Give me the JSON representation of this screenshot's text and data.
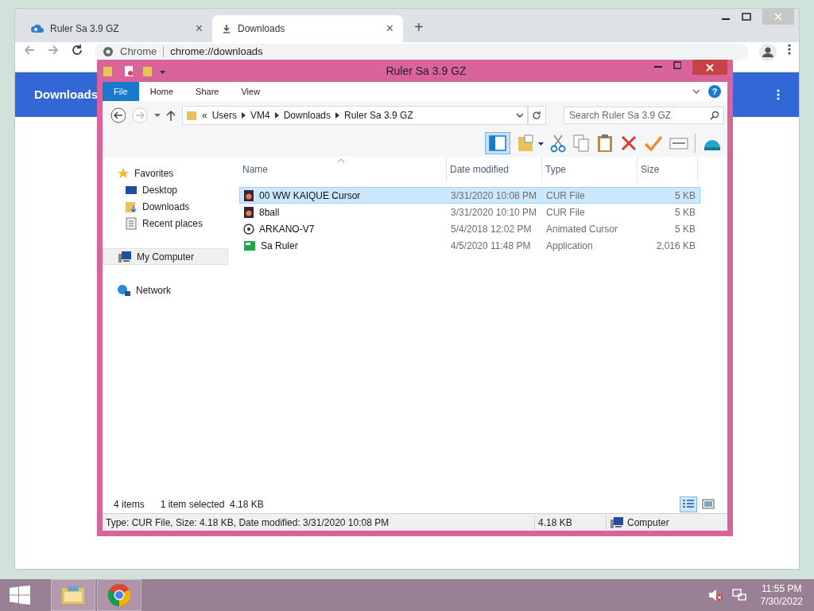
{
  "browser": {
    "tabs": [
      {
        "title": "Ruler Sa 3.9 GZ",
        "selected": false,
        "close": "×"
      },
      {
        "title": "Downloads",
        "selected": true,
        "close": "×"
      }
    ],
    "new_tab": "+",
    "omnibox": {
      "label": "Chrome",
      "url": "chrome://downloads"
    },
    "page_title": "Downloads"
  },
  "explorer": {
    "title": "Ruler Sa 3.9 GZ",
    "ribbon_tabs": [
      {
        "label": "File",
        "selected": true
      },
      {
        "label": "Home",
        "selected": false
      },
      {
        "label": "Share",
        "selected": false
      },
      {
        "label": "View",
        "selected": false
      }
    ],
    "breadcrumb": [
      "«",
      "Users",
      "VM4",
      "Downloads",
      "Ruler Sa 3.9 GZ"
    ],
    "help": "?",
    "search": {
      "placeholder": "Search Ruler Sa 3.9 GZ"
    },
    "sidebar": [
      {
        "label": "Favorites",
        "kind": "star",
        "children": [
          {
            "label": "Desktop",
            "kind": "desktop"
          },
          {
            "label": "Downloads",
            "kind": "downloads"
          },
          {
            "label": "Recent places",
            "kind": "recent"
          }
        ]
      },
      {
        "label": "My Computer",
        "kind": "computer",
        "selected": true
      },
      {
        "label": "Network",
        "kind": "network"
      }
    ],
    "columns": [
      "Name",
      "Date modified",
      "Type",
      "Size"
    ],
    "rows": [
      {
        "kind": "cur",
        "name": "00 WW KAIQUE Cursor",
        "date": "3/31/2020 10:08 PM",
        "type": "CUR File",
        "size": "5 KB",
        "selected": true
      },
      {
        "kind": "cur",
        "name": "8ball",
        "date": "3/31/2020 10:10 PM",
        "type": "CUR File",
        "size": "5 KB",
        "selected": false
      },
      {
        "kind": "ani",
        "name": "ARKANO-V7",
        "date": "5/4/2018 12:02 PM",
        "type": "Animated Cursor",
        "size": "5 KB",
        "selected": false
      },
      {
        "kind": "app",
        "name": "Sa Ruler",
        "date": "4/5/2020 11:48 PM",
        "type": "Application",
        "size": "2,016 KB",
        "selected": false
      }
    ],
    "footer": {
      "count": "4 items",
      "selection": "1 item selected  4.18 KB"
    },
    "status_bar": {
      "details": "Type: CUR File, Size: 4.18 KB, Date modified: 3/31/2020 10:08 PM",
      "size": "4.18 KB",
      "location": "Computer"
    }
  },
  "taskbar": {
    "time": "11:55 PM",
    "date": "7/30/2022"
  }
}
